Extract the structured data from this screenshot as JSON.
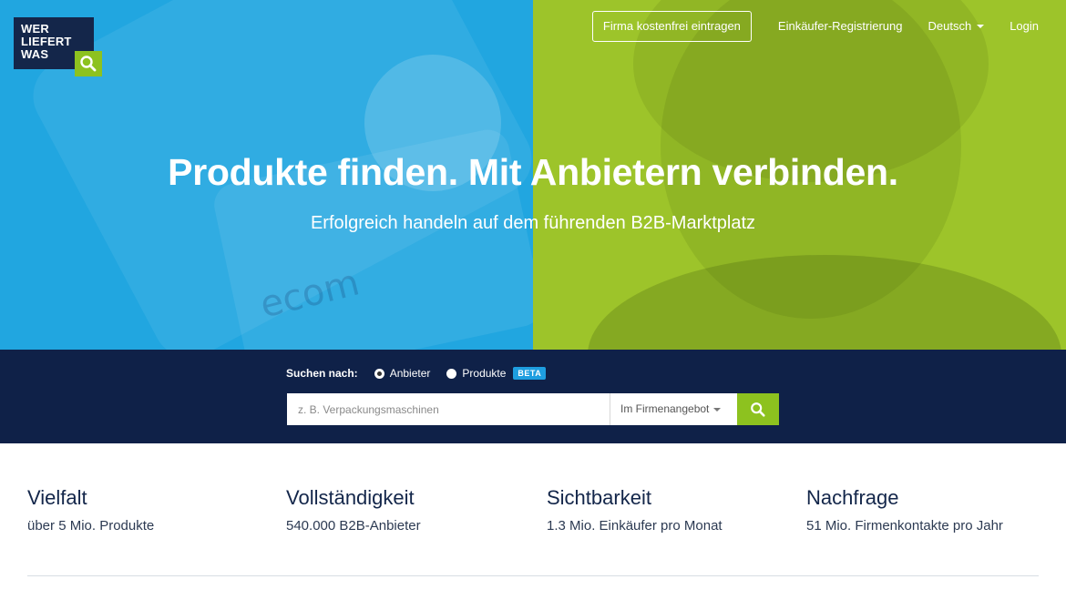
{
  "logo": {
    "line1": "WER",
    "line2": "LIEFERT",
    "line3": "WAS"
  },
  "nav": {
    "register_company": "Firma kostenfrei eintragen",
    "buyer_registration": "Einkäufer-Registrierung",
    "language": "Deutsch",
    "login": "Login"
  },
  "hero": {
    "title": "Produkte finden. Mit Anbietern verbinden.",
    "subtitle": "Erfolgreich handeln auf dem führenden B2B-Marktplatz",
    "device_label": "ecom"
  },
  "search": {
    "label": "Suchen nach:",
    "options": [
      {
        "label": "Anbieter",
        "checked": true
      },
      {
        "label": "Produkte",
        "checked": false
      }
    ],
    "beta": "BETA",
    "placeholder": "z. B. Verpackungsmaschinen",
    "scope": "Im Firmenangebot"
  },
  "features": [
    {
      "title": "Vielfalt",
      "text": "über 5 Mio. Produkte"
    },
    {
      "title": "Vollständigkeit",
      "text": "540.000 B2B-Anbieter"
    },
    {
      "title": "Sichtbarkeit",
      "text": "1.3 Mio. Einkäufer pro Monat"
    },
    {
      "title": "Nachfrage",
      "text": "51 Mio. Firmenkontakte pro Jahr"
    }
  ],
  "colors": {
    "blue": "#21a6e0",
    "green": "#9dc42a",
    "navy": "#0f2148",
    "accent_green": "#8dc21f"
  }
}
